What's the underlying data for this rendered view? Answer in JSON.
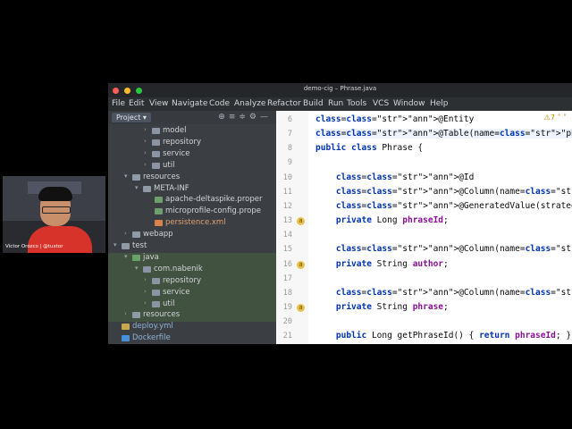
{
  "window": {
    "title": "demo-cig – Phrase.java",
    "traffic_lights": [
      "#ff5f57",
      "#febc2e",
      "#28c840"
    ]
  },
  "menu": [
    "File",
    "Edit",
    "View",
    "Navigate",
    "Code",
    "Analyze",
    "Refactor",
    "Build",
    "Run",
    "Tools",
    "VCS",
    "Window",
    "Help"
  ],
  "project_panel": {
    "label": "Project",
    "tree": [
      {
        "label": "model",
        "kind": "package",
        "expanded": false
      },
      {
        "label": "repository",
        "kind": "package",
        "expanded": false
      },
      {
        "label": "service",
        "kind": "package",
        "expanded": false
      },
      {
        "label": "util",
        "kind": "package",
        "expanded": false
      },
      {
        "label": "resources",
        "kind": "folder",
        "expanded": true
      },
      {
        "label": "META-INF",
        "kind": "folder",
        "expanded": true
      },
      {
        "label": "apache-deltaspike.proper",
        "kind": "file",
        "expanded": false
      },
      {
        "label": "microprofile-config.prope",
        "kind": "file",
        "expanded": false
      },
      {
        "label": "persistence.xml",
        "kind": "xml",
        "expanded": false
      },
      {
        "label": "webapp",
        "kind": "folder",
        "expanded": false
      },
      {
        "label": "test",
        "kind": "folder",
        "expanded": true
      },
      {
        "label": "java",
        "kind": "source",
        "expanded": true
      },
      {
        "label": "com.nabenik",
        "kind": "package",
        "expanded": true
      },
      {
        "label": "repository",
        "kind": "package",
        "expanded": false
      },
      {
        "label": "service",
        "kind": "package",
        "expanded": false
      },
      {
        "label": "util",
        "kind": "package",
        "expanded": false
      },
      {
        "label": "resources",
        "kind": "folder",
        "expanded": false
      },
      {
        "label": "deploy.yml",
        "kind": "yml",
        "expanded": false
      },
      {
        "label": "Dockerfile",
        "kind": "docker",
        "expanded": false
      }
    ]
  },
  "editor": {
    "warnings": "7",
    "lines": [
      {
        "n": "6",
        "text": "@Entity"
      },
      {
        "n": "7",
        "text": "@Table(name=\"phrase\")"
      },
      {
        "n": "8",
        "text": "public class Phrase {"
      },
      {
        "n": "9",
        "text": ""
      },
      {
        "n": "10",
        "text": "    @Id"
      },
      {
        "n": "11",
        "text": "    @Column(name=\"phrase_id\")"
      },
      {
        "n": "12",
        "text": "    @GeneratedValue(strategy = GenerationType.AUTO"
      },
      {
        "n": "13",
        "text": "    private Long phraseId;"
      },
      {
        "n": "14",
        "text": ""
      },
      {
        "n": "15",
        "text": "    @Column(name=\"author\")"
      },
      {
        "n": "16",
        "text": "    private String author;"
      },
      {
        "n": "17",
        "text": ""
      },
      {
        "n": "18",
        "text": "    @Column(name=\"phrase\")"
      },
      {
        "n": "19",
        "text": "    private String phrase;"
      },
      {
        "n": "20",
        "text": ""
      },
      {
        "n": "21",
        "text": "    public Long getPhraseId() { return phraseId; }"
      }
    ]
  },
  "webcam": {
    "caption": "Víctor Orozco | @tuxtor"
  }
}
